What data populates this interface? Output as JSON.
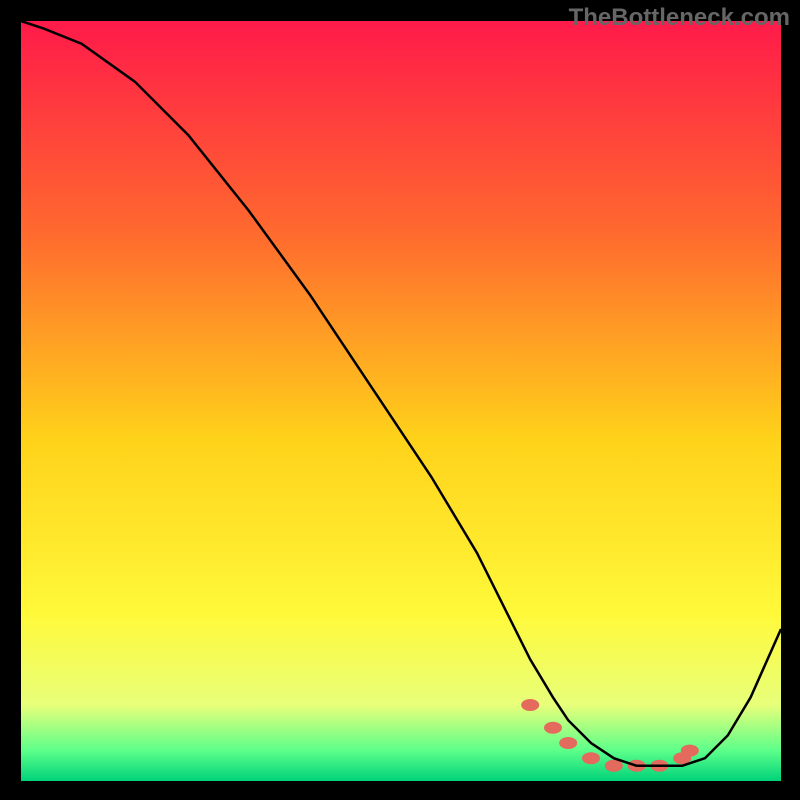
{
  "watermark": "TheBottleneck.com",
  "colors": {
    "top": "#ff1a4a",
    "mid1": "#ff6a2e",
    "mid2": "#ffd21a",
    "mid3": "#fff93a",
    "bottom1": "#e8ff7a",
    "bottom2": "#5cff8a",
    "bottom3": "#00d27a",
    "curve": "#000000",
    "marker": "#e36a5c"
  },
  "chart_data": {
    "type": "line",
    "title": "",
    "xlabel": "",
    "ylabel": "",
    "xlim": [
      0,
      100
    ],
    "ylim": [
      0,
      100
    ],
    "series": [
      {
        "name": "curve",
        "x": [
          0,
          3,
          8,
          15,
          22,
          30,
          38,
          46,
          54,
          60,
          64,
          67,
          70,
          72,
          75,
          78,
          81,
          84,
          87,
          90,
          93,
          96,
          100
        ],
        "y": [
          100,
          99,
          97,
          92,
          85,
          75,
          64,
          52,
          40,
          30,
          22,
          16,
          11,
          8,
          5,
          3,
          2,
          2,
          2,
          3,
          6,
          11,
          20
        ]
      }
    ],
    "markers": {
      "x": [
        67,
        70,
        72,
        75,
        78,
        81,
        84,
        87,
        88
      ],
      "y": [
        10,
        7,
        5,
        3,
        2,
        2,
        2,
        3,
        4
      ]
    }
  }
}
